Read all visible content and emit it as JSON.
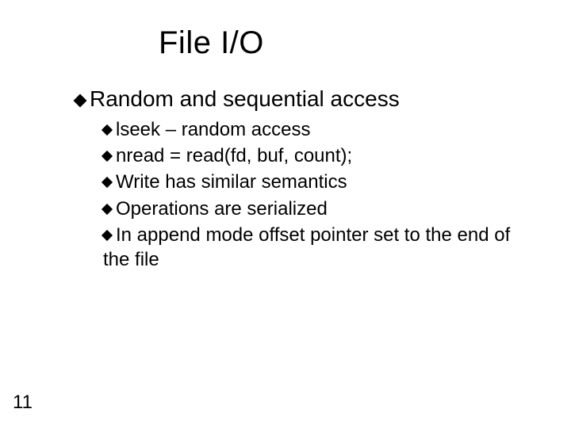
{
  "title": "File I/O",
  "level1": "Random and sequential access",
  "bullets": [
    "lseek – random access",
    "nread = read(fd, buf, count);",
    "Write has similar semantics",
    "Operations are serialized",
    "In append mode offset pointer set to the end of the file"
  ],
  "page_number": "11"
}
